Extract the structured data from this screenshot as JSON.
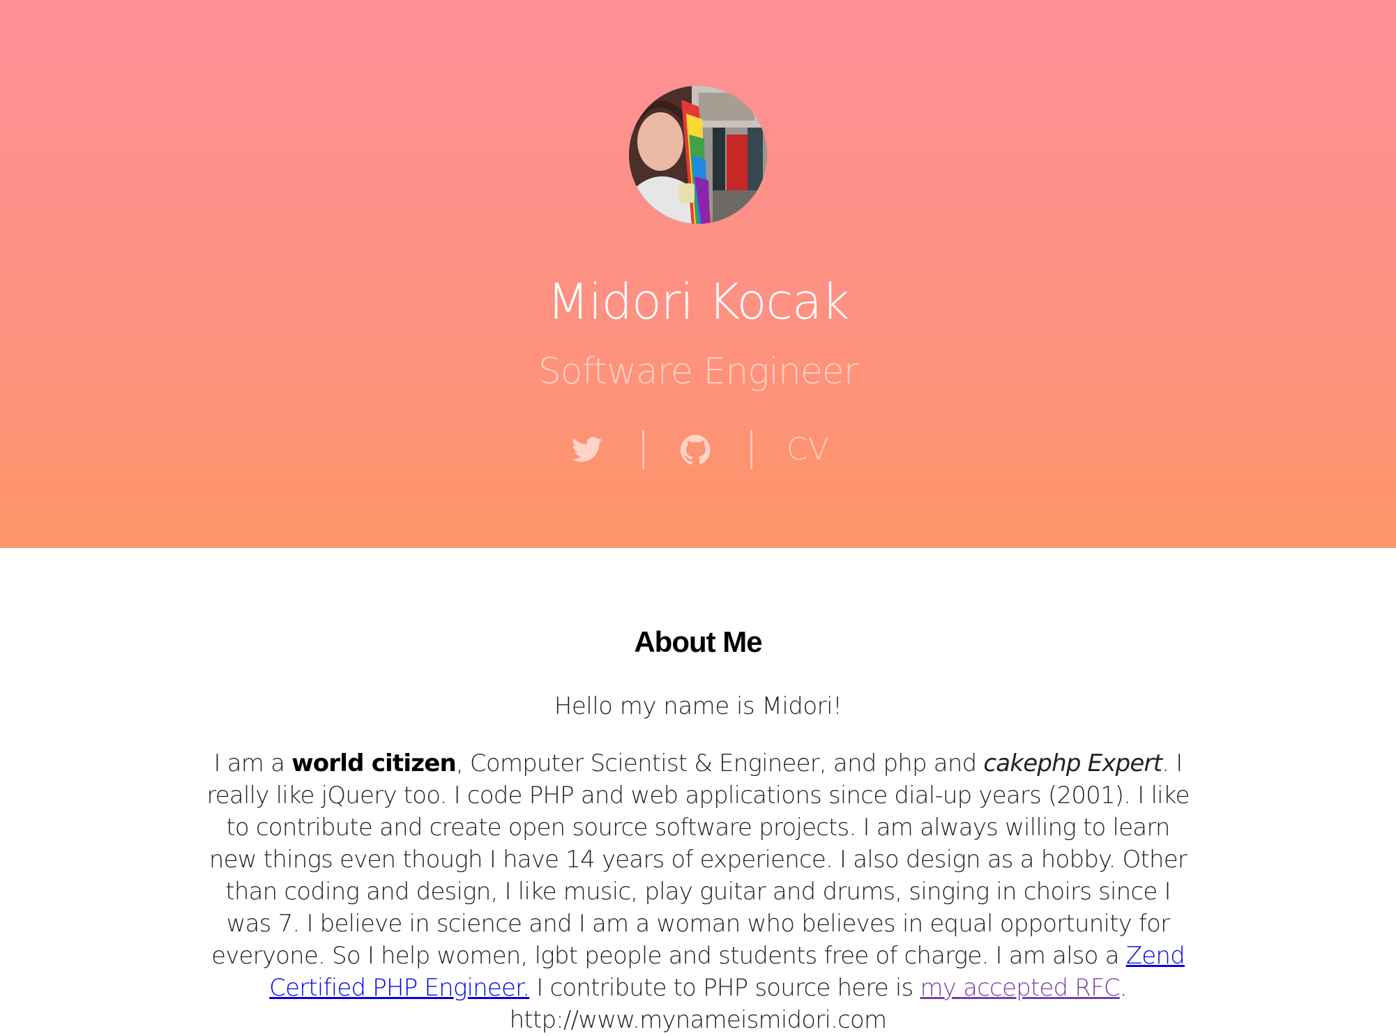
{
  "header": {
    "name": "Midori Kocak",
    "role": "Software Engineer",
    "cv_label": "CV",
    "icons": [
      "twitter-icon",
      "github-icon"
    ],
    "colors": {
      "gradient_top": "#fe8f98",
      "gradient_bottom": "#fe9468"
    }
  },
  "about": {
    "heading": "About Me",
    "hello": "Hello my name is Midori!",
    "bio": {
      "p1": "I am a ",
      "world_citizen": "world citizen",
      "p2": ", Computer Scientist & Engineer, and php and ",
      "cakephp_expert": "cakephp Expert",
      "p3": ". I really like jQuery too. I code PHP and web applications since dial-up years (2001). I like to contribute and create open source software projects. I am always willing to learn new things even though I have 14 years of experience. I also design as a hobby. Other than coding and design, I like music, play guitar and drums, singing in choirs since I was 7. I believe in science and I am a woman who believes in equal opportunity for everyone. So I help women, lgbt people and students free of charge. I am also a ",
      "zend_link": "Zend Certified PHP Engineer.",
      "p4": " I contribute to PHP source here is ",
      "rfc_link": "my accepted RFC",
      "p5": ". http://www.mynameismidori.com"
    }
  }
}
